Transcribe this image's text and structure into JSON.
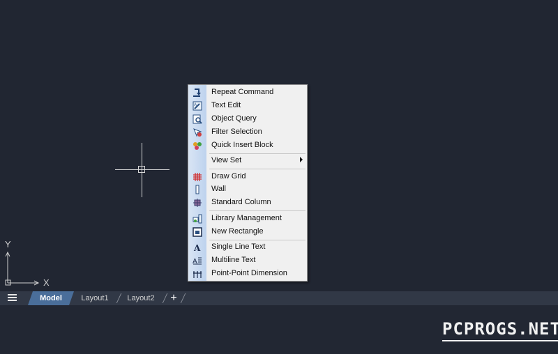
{
  "canvas": {
    "ucs": {
      "y_label": "Y",
      "x_label": "X"
    }
  },
  "context_menu": {
    "items": [
      {
        "label": "Repeat Command",
        "icon": "repeat-icon"
      },
      {
        "label": "Text Edit",
        "icon": "text-edit-icon"
      },
      {
        "label": "Object Query",
        "icon": "object-query-icon"
      },
      {
        "label": "Filter Selection",
        "icon": "filter-selection-icon"
      },
      {
        "label": "Quick Insert Block",
        "icon": "insert-block-icon"
      },
      {
        "label": "View Set",
        "icon": "",
        "has_submenu": true
      },
      {
        "label": "Draw Grid",
        "icon": "grid-icon"
      },
      {
        "label": "Wall",
        "icon": "wall-icon"
      },
      {
        "label": "Standard Column",
        "icon": "column-icon"
      },
      {
        "label": "Library Management",
        "icon": "library-icon"
      },
      {
        "label": "New Rectangle",
        "icon": "rectangle-icon"
      },
      {
        "label": "Single Line Text",
        "icon": "single-line-text-icon"
      },
      {
        "label": "Multiline Text",
        "icon": "multiline-text-icon"
      },
      {
        "label": "Point-Point Dimension",
        "icon": "dimension-icon"
      }
    ]
  },
  "tabbar": {
    "tabs": [
      {
        "label": "Model",
        "active": true
      },
      {
        "label": "Layout1",
        "active": false
      },
      {
        "label": "Layout2",
        "active": false
      }
    ],
    "add_label": "+"
  },
  "watermark": {
    "text": "PCPROGS.NET"
  },
  "colors": {
    "canvas": "#212632",
    "tabbar": "#313846",
    "active_tab": "#4a6e9a",
    "menu_bg": "#f0f0f0"
  }
}
